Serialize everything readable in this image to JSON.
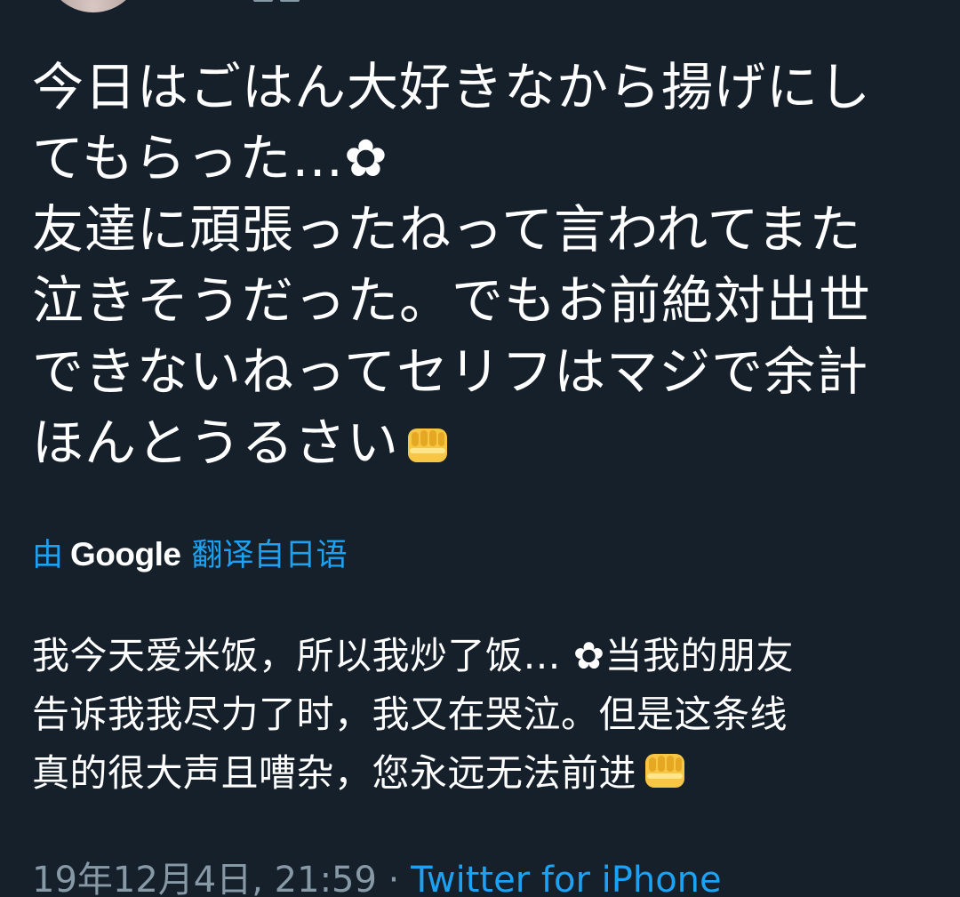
{
  "tweet": {
    "original_lines": [
      "今日はごはん大好きなから揚げにし",
      "てもらった…✿",
      "友達に頑張ったねって言われてまた",
      "泣きそうだった。でもお前絶対出世",
      "できないねってセリフはマジで余計",
      "ほんとうるさい"
    ],
    "translation_prefix": "由",
    "translation_brand": "Google",
    "translation_suffix": "翻译自日语",
    "translated_lines": [
      "我今天爱米饭，所以我炒了饭… ✿当我的朋友",
      "告诉我我尽力了时，我又在哭泣。但是这条线",
      "真的很大声且嘈杂，您永远无法前进"
    ],
    "timestamp": "19年12月4日, 21:59",
    "separator": "·",
    "source": "Twitter for iPhone"
  },
  "icons": {
    "fist_emoji": "oncoming-fist-icon"
  }
}
